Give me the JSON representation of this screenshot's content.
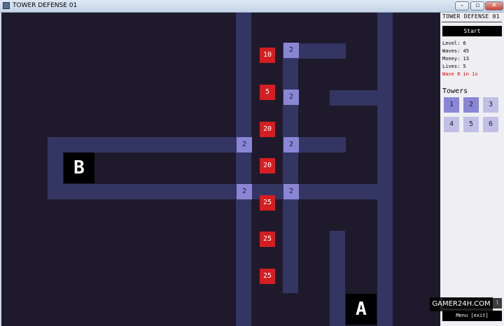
{
  "window": {
    "title": "TOWER DEFENSE 01",
    "min_label": "–",
    "max_label": "▫",
    "close_label": "✕"
  },
  "map": {
    "towers": [
      "2",
      "2",
      "2",
      "2",
      "2",
      "2"
    ],
    "enemies": [
      "10",
      "5",
      "20",
      "20",
      "25",
      "25",
      "25"
    ],
    "base_b": "B",
    "base_a": "A"
  },
  "panel": {
    "title": "TOWER DEFENSE 01",
    "start_label": "Start",
    "level": "Level: 6",
    "waves": "Waves: 45",
    "money": "Money: 13",
    "lives": "Lives: 5",
    "wave_notice": "Wave 8 in 1s",
    "towers_heading": "Towers",
    "tower_buttons": [
      "1",
      "2",
      "3",
      "4",
      "5",
      "6"
    ],
    "menu_tab": "l",
    "menu_label": "Menu [exit]"
  },
  "watermark": "GAMER24H.COM",
  "colors": {
    "field_bg": "#1f1a2b",
    "road": "#333563",
    "tower": "#8a86d6",
    "enemy": "#d41e22",
    "warning_text": "#ee0000"
  }
}
